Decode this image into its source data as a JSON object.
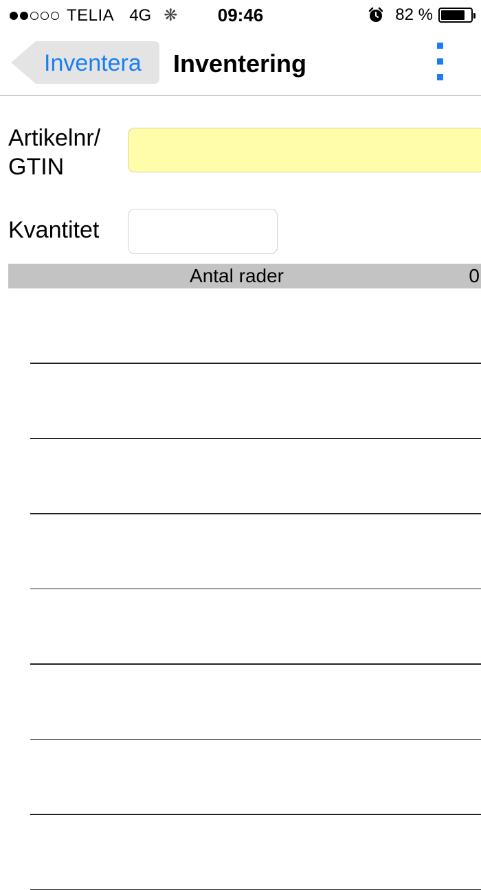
{
  "status_bar": {
    "signal_filled": 2,
    "signal_empty": 3,
    "carrier": "TELIA",
    "network": "4G",
    "activity_icon": "loading-spinner-icon",
    "time": "09:46",
    "alarm_icon": "alarm-clock-icon",
    "battery_text": "82 %",
    "battery_level": 0.82
  },
  "nav": {
    "back_label": "Inventera",
    "title": "Inventering",
    "menu_icon": "vertical-dots-menu-icon",
    "accent_color": "#1a7ef2"
  },
  "form": {
    "artikel_label": "Artikelnr/ GTIN",
    "artikel_value": "",
    "artikel_bg_color": "#fffcaa",
    "kvantitet_label": "Kvantitet",
    "kvantitet_value": ""
  },
  "summary": {
    "label": "Antal rader",
    "count": "0"
  },
  "rows": [
    "",
    "",
    "",
    "",
    "",
    "",
    "",
    ""
  ]
}
